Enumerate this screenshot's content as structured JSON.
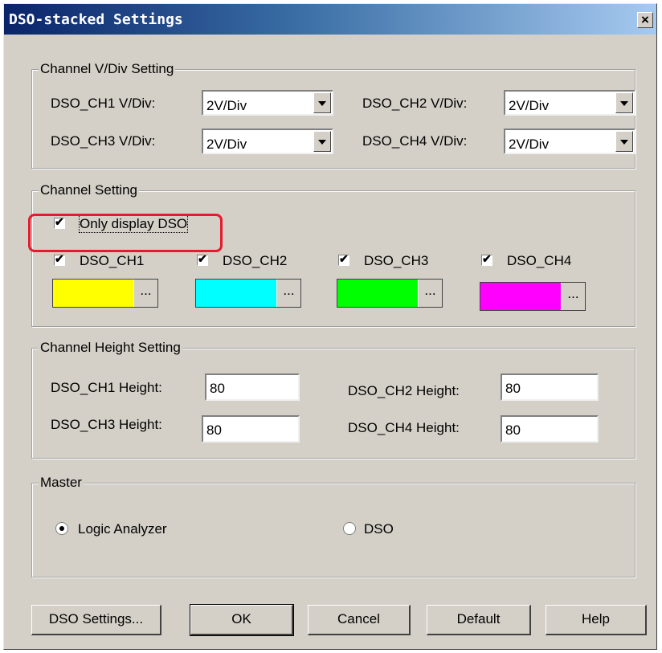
{
  "window": {
    "title": "DSO-stacked Settings",
    "close_label": "×"
  },
  "vdiv_group": {
    "legend": "Channel V/Div Setting",
    "channels": [
      {
        "label": "DSO_CH1 V/Div:",
        "value": "2V/Div"
      },
      {
        "label": "DSO_CH2 V/Div:",
        "value": "2V/Div"
      },
      {
        "label": "DSO_CH3 V/Div:",
        "value": "2V/Div"
      },
      {
        "label": "DSO_CH4 V/Div:",
        "value": "2V/Div"
      }
    ]
  },
  "channel_group": {
    "legend": "Channel Setting",
    "only_display": {
      "label": "Only display DSO",
      "checked": true
    },
    "channels": [
      {
        "label": "DSO_CH1",
        "checked": true,
        "color": "#ffff00",
        "button": "..."
      },
      {
        "label": "DSO_CH2",
        "checked": true,
        "color": "#00ffff",
        "button": "..."
      },
      {
        "label": "DSO_CH3",
        "checked": true,
        "color": "#00ff00",
        "button": "..."
      },
      {
        "label": "DSO_CH4",
        "checked": true,
        "color": "#ff00ff",
        "button": "..."
      }
    ]
  },
  "height_group": {
    "legend": "Channel Height Setting",
    "channels": [
      {
        "label": "DSO_CH1 Height:",
        "value": "80"
      },
      {
        "label": "DSO_CH2 Height:",
        "value": "80"
      },
      {
        "label": "DSO_CH3 Height:",
        "value": "80"
      },
      {
        "label": "DSO_CH4 Height:",
        "value": "80"
      }
    ]
  },
  "master_group": {
    "legend": "Master",
    "options": [
      {
        "label": "Logic Analyzer",
        "selected": true
      },
      {
        "label": "DSO",
        "selected": false
      }
    ]
  },
  "buttons": {
    "dso_settings": "DSO Settings...",
    "ok": "OK",
    "cancel": "Cancel",
    "default": "Default",
    "help": "Help"
  },
  "colors": {
    "highlight": "#e8192c"
  }
}
